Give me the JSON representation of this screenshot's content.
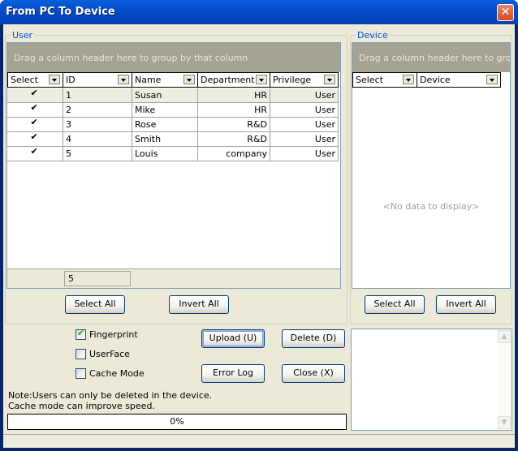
{
  "window": {
    "title": "From PC To Device",
    "close_label": "✕"
  },
  "user_group": {
    "label": "User",
    "group_panel_text": "Drag a column header here to group by that column",
    "columns": [
      "Select",
      "ID",
      "Name",
      "Department",
      "Privilege"
    ],
    "rows": [
      {
        "selected": true,
        "id": "1",
        "name": "Susan",
        "department": "HR",
        "privilege": "User"
      },
      {
        "selected": true,
        "id": "2",
        "name": "Mike",
        "department": "HR",
        "privilege": "User"
      },
      {
        "selected": true,
        "id": "3",
        "name": "Rose",
        "department": "R&D",
        "privilege": "User"
      },
      {
        "selected": true,
        "id": "4",
        "name": "Smith",
        "department": "R&D",
        "privilege": "User"
      },
      {
        "selected": true,
        "id": "5",
        "name": "Louis",
        "department": "company",
        "privilege": "User"
      }
    ],
    "count": "5",
    "select_all_label": "Select All",
    "invert_all_label": "Invert All"
  },
  "device_group": {
    "label": "Device",
    "group_panel_text": "Drag a column header here to group by that column",
    "columns": [
      "Select",
      "Device"
    ],
    "empty_text": "<No data to display>",
    "select_all_label": "Select All",
    "invert_all_label": "Invert All"
  },
  "options": {
    "fingerprint": {
      "label": "Fingerprint",
      "checked": true
    },
    "userface": {
      "label": "UserFace",
      "checked": false
    },
    "cache_mode": {
      "label": "Cache Mode",
      "checked": false
    }
  },
  "actions": {
    "upload_label": "Upload (U)",
    "delete_label": "Delete (D)",
    "error_log_label": "Error Log",
    "close_label": "Close (X)"
  },
  "notes": {
    "line1": "Note:Users can only be deleted in the device.",
    "line2": "Cache mode can improve speed."
  },
  "progress": {
    "percent": 0,
    "label": "0%"
  }
}
